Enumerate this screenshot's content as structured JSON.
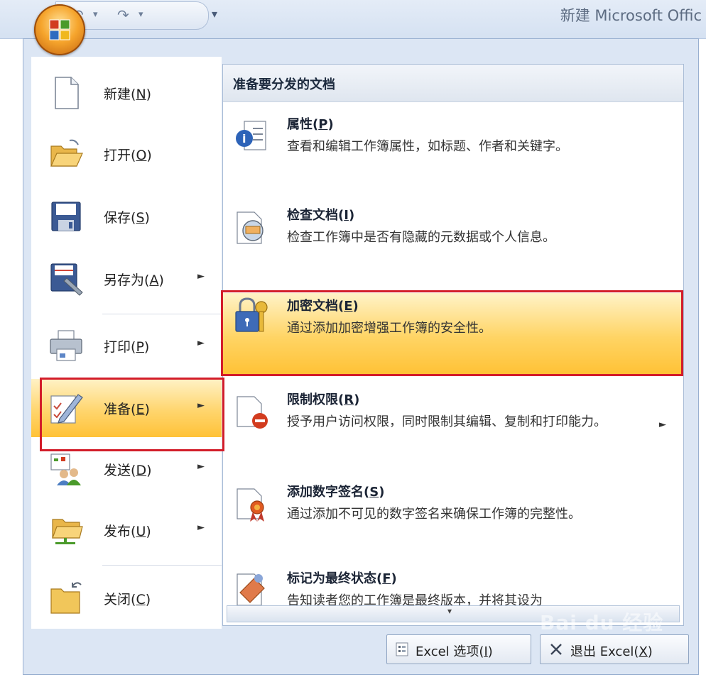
{
  "window": {
    "title": "新建 Microsoft Offic"
  },
  "quick_access": {
    "undo_label": "↶",
    "undo_dropdown": "▾",
    "redo_label": "↷",
    "redo_dropdown": "▾",
    "customize": "▾"
  },
  "left_menu": {
    "items": [
      {
        "label": "新建",
        "key": "N",
        "icon": "new-document-icon",
        "submenu": false
      },
      {
        "label": "打开",
        "key": "O",
        "icon": "open-folder-icon",
        "submenu": false
      },
      {
        "label": "保存",
        "key": "S",
        "icon": "save-disk-icon",
        "submenu": false
      },
      {
        "label": "另存为",
        "key": "A",
        "icon": "save-as-icon",
        "submenu": true
      },
      {
        "label": "打印",
        "key": "P",
        "icon": "printer-icon",
        "submenu": true
      },
      {
        "label": "准备",
        "key": "E",
        "icon": "prepare-pencil-icon",
        "submenu": true,
        "selected": true
      },
      {
        "label": "发送",
        "key": "D",
        "icon": "send-people-icon",
        "submenu": true
      },
      {
        "label": "发布",
        "key": "U",
        "icon": "publish-folder-icon",
        "submenu": true
      },
      {
        "label": "关闭",
        "key": "C",
        "icon": "close-folder-icon",
        "submenu": false
      }
    ]
  },
  "prepare_panel": {
    "title": "准备要分发的文档",
    "options": [
      {
        "title": "属性",
        "key": "P",
        "desc": "查看和编辑工作簿属性，如标题、作者和关键字。",
        "icon": "properties-info-icon"
      },
      {
        "title": "检查文档",
        "key": "I",
        "desc": "检查工作簿中是否有隐藏的元数据或个人信息。",
        "icon": "inspect-document-icon"
      },
      {
        "title": "加密文档",
        "key": "E",
        "desc": "通过添加加密增强工作簿的安全性。",
        "icon": "encrypt-lock-key-icon",
        "selected": true
      },
      {
        "title": "限制权限",
        "key": "R",
        "desc": "授予用户访问权限，同时限制其编辑、复制和打印能力。",
        "icon": "restrict-permission-icon",
        "submenu": true
      },
      {
        "title": "添加数字签名",
        "key": "S",
        "desc": "通过添加不可见的数字签名来确保工作簿的完整性。",
        "icon": "digital-signature-icon"
      },
      {
        "title": "标记为最终状态",
        "key": "F",
        "desc": "告知读者您的工作簿是最终版本，并将其设为",
        "icon": "mark-final-icon"
      }
    ],
    "scroll_down": "▾"
  },
  "footer": {
    "options_label": "Excel 选项",
    "options_key": "I",
    "exit_label": "退出 Excel",
    "exit_key": "X"
  },
  "watermark": "Bai du 经验",
  "colors": {
    "highlight": "#ffd15c",
    "annotation_red": "#d31d2a",
    "menu_bg": "#dce6f4"
  }
}
